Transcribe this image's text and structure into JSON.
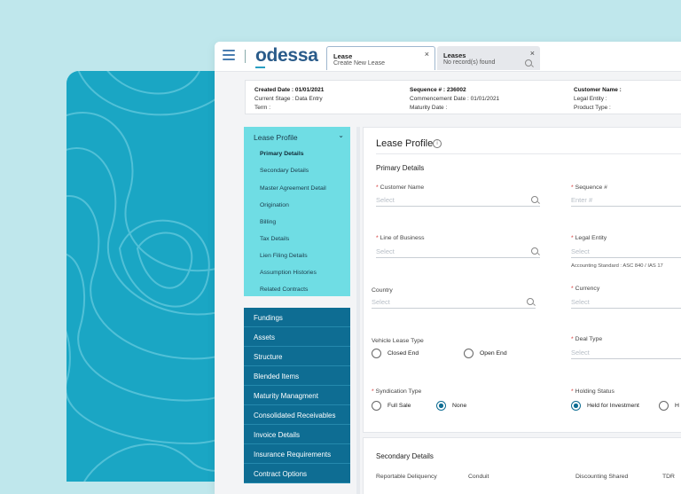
{
  "app": {
    "logo": "odessa"
  },
  "tabs": [
    {
      "title": "Lease",
      "subtitle": "Create New Lease",
      "close": "×"
    },
    {
      "title": "Leases",
      "subtitle": "No record(s) found",
      "close": "×",
      "search": "🔍"
    }
  ],
  "summary": {
    "col1": [
      "Created Date : 01/01/2021",
      "Current Stage : Data Entry",
      "Term :"
    ],
    "col2": [
      "Sequence # : 236002",
      "Commencement Date : 01/01/2021",
      "Maturity Date :"
    ],
    "col3": [
      "Customer Name :",
      "Legal Entity :",
      "Product Type :"
    ]
  },
  "nav": {
    "section_title": "Lease Profile",
    "chevron": "⌄",
    "sub_items": [
      "Primary Details",
      "Secondary Details",
      "Master Agreement Detail",
      "Origination",
      "Billing",
      "Tax Details",
      "Lien Filing Details",
      "Assumption Histories",
      "Related Contracts"
    ],
    "items": [
      "Fundings",
      "Assets",
      "Structure",
      "Blended Items",
      "Maturity Managment",
      "Consolidated Receivables",
      "Invoice Details",
      "Insurance Requirements",
      "Contract Options"
    ]
  },
  "form": {
    "title": "Lease Profile",
    "info": "i",
    "subtitle": "Primary Details",
    "customer_name": {
      "label": "Customer Name",
      "placeholder": "Select"
    },
    "sequence": {
      "label": "Sequence #",
      "placeholder": "Enter #"
    },
    "line_of_business": {
      "label": "Line of Business",
      "placeholder": "Select"
    },
    "legal_entity": {
      "label": "Legal Entity",
      "placeholder": "Select",
      "note": "Accounting Standard : ASC 840 / IAS 17"
    },
    "country": {
      "label": "Country",
      "placeholder": "Select"
    },
    "currency": {
      "label": "Currency",
      "placeholder": "Select"
    },
    "vehicle_lease_type": {
      "label": "Vehicle Lease Type",
      "options": [
        "Closed End",
        "Open End"
      ]
    },
    "deal_type": {
      "label": "Deal Type",
      "placeholder": "Select"
    },
    "syndication_type": {
      "label": "Syndication Type",
      "options": [
        "Full Sale",
        "None"
      ],
      "selected": "None"
    },
    "holding_status": {
      "label": "Holding Status",
      "options": [
        "Held for Investment",
        "H"
      ],
      "selected": "Held for Investment"
    }
  },
  "secondary": {
    "title": "Secondary Details",
    "columns": [
      "Reportable Deliquency",
      "Conduit",
      "Discounting Shared",
      "TDR"
    ]
  }
}
